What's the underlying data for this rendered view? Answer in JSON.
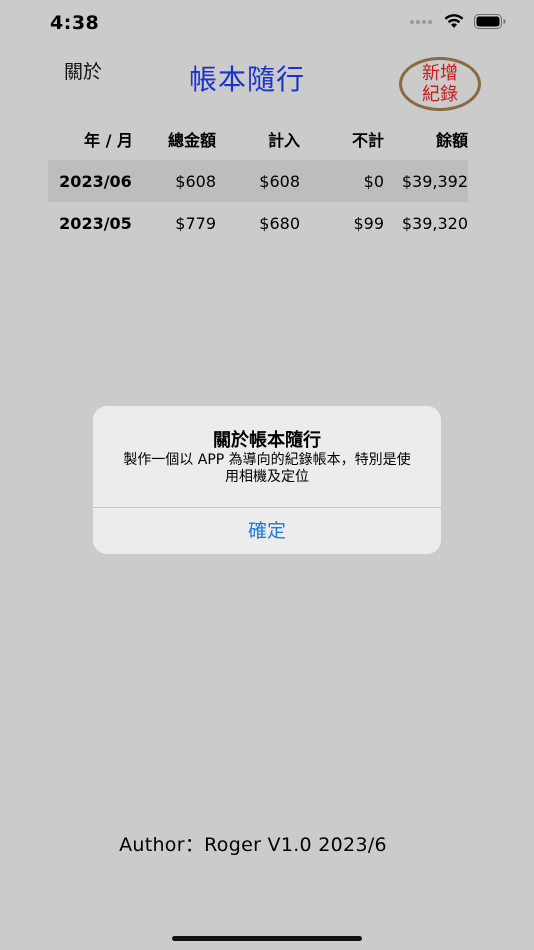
{
  "status_bar": {
    "time": "4:38",
    "icons": [
      "signal-dots-icon",
      "wifi-icon",
      "battery-icon"
    ]
  },
  "nav": {
    "about_label": "關於",
    "title": "帳本隨行",
    "add_label": "新增\n紀錄",
    "title_color": "#1a33cc",
    "add_color": "#cc1a1a",
    "add_border_color": "#8a6a3e"
  },
  "table": {
    "headers": [
      "年 / 月",
      "總金額",
      "計入",
      "不計",
      "餘額"
    ],
    "rows": [
      {
        "month": "2023/06",
        "total": "$608",
        "counted": "$608",
        "uncounted": "$0",
        "balance": "$39,392"
      },
      {
        "month": "2023/05",
        "total": "$779",
        "counted": "$680",
        "uncounted": "$99",
        "balance": "$39,320"
      }
    ]
  },
  "alert": {
    "title": "關於帳本隨行",
    "message": "製作一個以 APP 為導向的紀錄帳本，特別是使用相機及定位",
    "button_label": "確定",
    "button_color": "#1f7ae0"
  },
  "footer": {
    "text": "Author：Roger  V1.0 2023/6"
  }
}
